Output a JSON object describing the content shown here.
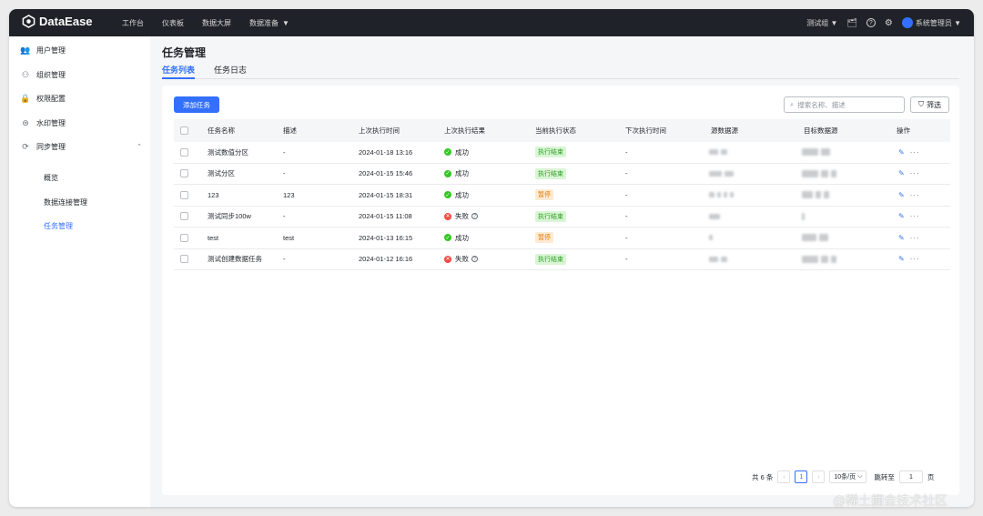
{
  "app": {
    "name": "DataEase",
    "nav": [
      "工作台",
      "仪表板",
      "数据大屏",
      "数据准备"
    ],
    "org": "测试组",
    "user": "系统管理员"
  },
  "sidebar": {
    "items": [
      {
        "label": "用户管理",
        "icon": "user-icon"
      },
      {
        "label": "组织管理",
        "icon": "org-icon"
      },
      {
        "label": "权限配置",
        "icon": "lock-icon"
      },
      {
        "label": "水印管理",
        "icon": "watermark-icon"
      },
      {
        "label": "同步管理",
        "icon": "sync-icon"
      }
    ],
    "sub": [
      "概览",
      "数据连接管理",
      "任务管理"
    ]
  },
  "page": {
    "title": "任务管理",
    "tabs": [
      "任务列表",
      "任务日志"
    ],
    "add_button": "添加任务",
    "search_placeholder": "搜索名称、描述",
    "filter": "筛选"
  },
  "table": {
    "columns": [
      "任务名称",
      "描述",
      "上次执行时间",
      "上次执行结果",
      "当前执行状态",
      "下次执行时间",
      "源数据源",
      "目标数据源",
      "操作"
    ],
    "rows": [
      {
        "name": "测试数值分区",
        "desc": "-",
        "last_time": "2024-01-18  13:16",
        "result": "成功",
        "ok": true,
        "state": "执行结束",
        "next": "-"
      },
      {
        "name": "测试分区",
        "desc": "-",
        "last_time": "2024-01-15  15:46",
        "result": "成功",
        "ok": true,
        "state": "执行结束",
        "next": "-"
      },
      {
        "name": "123",
        "desc": "123",
        "last_time": "2024-01-15  18:31",
        "result": "成功",
        "ok": true,
        "state": "暂停",
        "next": "-"
      },
      {
        "name": "测试同步100w",
        "desc": "-",
        "last_time": "2024-01-15  11:08",
        "result": "失败",
        "ok": false,
        "state": "执行结束",
        "next": "-"
      },
      {
        "name": "test",
        "desc": "test",
        "last_time": "2024-01-13  16:15",
        "result": "成功",
        "ok": true,
        "state": "暂停",
        "next": "-"
      },
      {
        "name": "测试创建数据任务",
        "desc": "-",
        "last_time": "2024-01-12  16:16",
        "result": "失败",
        "ok": false,
        "state": "执行结束",
        "next": "-"
      }
    ]
  },
  "pager": {
    "total_prefix": "共",
    "total": "6",
    "total_suffix": "条",
    "current": "1",
    "page_size": "10条/页",
    "jump_label": "跳转至",
    "jump_value": "1",
    "page_suffix": "页"
  },
  "watermark": "@稀土掘金技术社区",
  "colors": {
    "accent": "#3370ff",
    "success": "#34c724",
    "fail": "#f54a45",
    "topbar": "#1f2329"
  }
}
